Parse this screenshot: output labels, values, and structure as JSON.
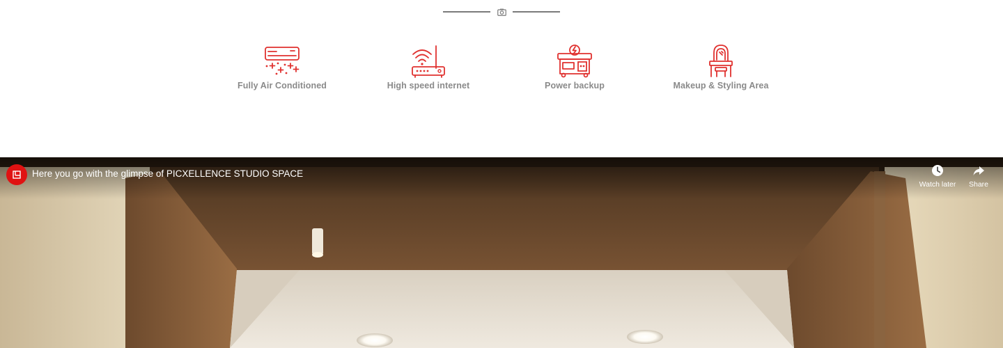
{
  "divider": {
    "icon": "camera-icon"
  },
  "amenities": [
    {
      "icon": "air-conditioner-icon",
      "label": "Fully Air Conditioned"
    },
    {
      "icon": "wifi-router-icon",
      "label": "High speed internet"
    },
    {
      "icon": "generator-icon",
      "label": "Power backup"
    },
    {
      "icon": "dressing-table-icon",
      "label": "Makeup & Styling Area"
    }
  ],
  "video": {
    "title": "Here you go with the glimpse of PICXELLENCE STUDIO SPACE",
    "channel_icon": "channel-logo-icon",
    "actions": {
      "watch_later": {
        "icon": "clock-icon",
        "label": "Watch later"
      },
      "share": {
        "icon": "share-arrow-icon",
        "label": "Share"
      }
    }
  },
  "colors": {
    "accent": "#e0312f",
    "label_gray": "#8a8a8a",
    "divider_gray": "#7a7a7a",
    "channel_red": "#e01212"
  }
}
